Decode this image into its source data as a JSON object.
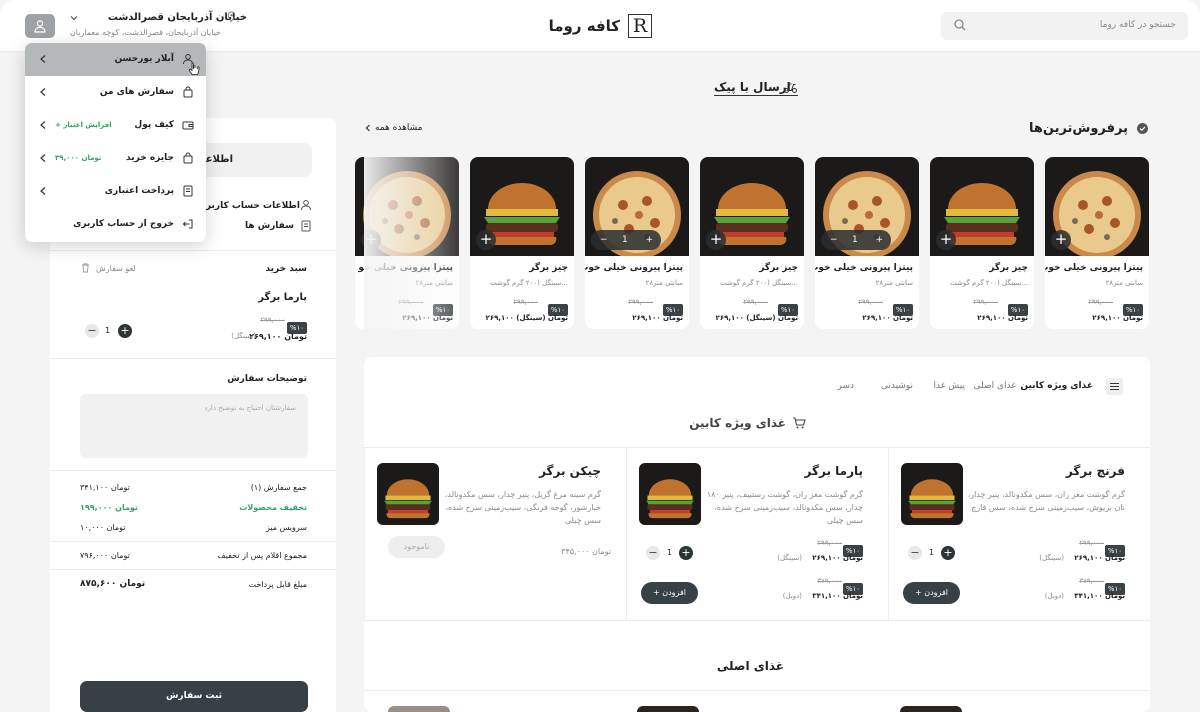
{
  "header": {
    "brand_name": "کافه روما",
    "brand_mark": "R",
    "search_placeholder": "جستجو در کافه روما",
    "address_title": "خیابان آذربایجان قصرالدشت",
    "address_sub": "خیابان آذربایجان، قصرالدشت، کوچه معماریان"
  },
  "user_menu": {
    "items": [
      {
        "label": "آبلار یورحسن",
        "extra": ""
      },
      {
        "label": "سفارش های من",
        "extra": ""
      },
      {
        "label": "کیف پول",
        "extra": "+ افزایش اعتبار"
      },
      {
        "label": "جایزه خرید",
        "extra": "۳۹,۰۰۰ تومان"
      },
      {
        "label": "پرداخت اعتباری",
        "extra": ""
      },
      {
        "label": "خروج از حساب کاربری",
        "extra": ""
      }
    ]
  },
  "side": {
    "account_tab": "اطلاعا",
    "links": [
      "اطلاعات حساب کاربری",
      "سفارش ها"
    ],
    "cart_title": "سبد خرید",
    "cancel_order": "لغو سفارش",
    "item_name": "پارما برگر",
    "item_discount": "%۱۰",
    "item_old_price": "۲۹۹,۰۰۰",
    "item_price": "۲۶۹,۱۰۰ تومان",
    "item_variant": "(سینگل)",
    "item_qty": "1",
    "notes_title": "توضیحات سفارش",
    "notes_placeholder": "سفارشتان احتیاج به توضیح دارد",
    "summary": [
      {
        "label": "جمع سفارش (۱)",
        "value": "۳۴۱,۱۰۰ تومان"
      },
      {
        "label": "تخفیف محصولات",
        "value": "۱۹۹,۰۰۰ تومان"
      },
      {
        "label": "سرویس میز",
        "value": "۱۰,۰۰۰ تومان"
      },
      {
        "label": "مجموع اقلام پس از تخفیف",
        "value": "۷۹۶,۰۰۰ تومان"
      },
      {
        "label": "مبلغ قابل پرداخت",
        "value": "۸۷۵,۶۰۰ تومان"
      }
    ],
    "submit_label": "ثبت سفارش"
  },
  "main": {
    "delivery_label": "ارسال با پیک",
    "bestsellers_title": "پرفروش‌ترین‌ها",
    "see_all": "مشاهده همه",
    "cards": [
      {
        "name": "پیتزا پیرونی خیلی خوب",
        "sub": "۲۸سانتی متر",
        "discount": "%۱۰",
        "old": "۲۹۹,۰۰۰",
        "price": "۲۶۹,۱۰۰ تومان",
        "kind": "pizza",
        "qty": ""
      },
      {
        "name": "چیز برگر",
        "sub": "سینگل (۲۰۰ گرم گوشت...",
        "discount": "%۱۰",
        "old": "۲۹۹,۰۰۰",
        "price": "۲۶۹,۱۰۰ تومان",
        "kind": "burger",
        "qty": ""
      },
      {
        "name": "پیتزا پیرونی خیلی خوب",
        "sub": "۲۸سانتی متر",
        "discount": "%۱۰",
        "old": "۲۹۹,۰۰۰",
        "price": "۲۶۹,۱۰۰ تومان",
        "kind": "pizza",
        "qty": "1"
      },
      {
        "name": "چیز برگر",
        "sub": "سینگل (۲۰۰ گرم گوشت...",
        "discount": "%۱۰",
        "old": "۲۹۹,۰۰۰",
        "price": "۲۶۹,۱۰۰ تومان (سینگل)",
        "kind": "burger",
        "qty": ""
      },
      {
        "name": "پیتزا پیرونی خیلی خوب",
        "sub": "۲۸سانتی متر",
        "discount": "%۱۰",
        "old": "۲۹۹,۰۰۰",
        "price": "۲۶۹,۱۰۰ تومان",
        "kind": "pizza",
        "qty": "1"
      },
      {
        "name": "چیز برگر",
        "sub": "سینگل (۲۰۰ گرم گوشت...",
        "discount": "%۱۰",
        "old": "۲۹۹,۰۰۰",
        "price": "۲۶۹,۱۰۰ تومان (سینگل)",
        "kind": "burger",
        "qty": ""
      },
      {
        "name": "پیتزا پیرونی خیلی خو",
        "sub": "۲۸سانتی متر",
        "discount": "%۱۰",
        "old": "۲۹۹,۰۰۰",
        "price": "۲۶۹,۱۰۰ تومان",
        "kind": "pizza",
        "qty": ""
      }
    ],
    "tabs": [
      "غذای ویژه کابین",
      "غذای اصلی",
      "پیش غذا",
      "نوشیدنی",
      "دسر"
    ],
    "special_title": "غذای ویژه کابین",
    "main_title": "غذای اصلی",
    "foods": [
      {
        "name": "فرنچ برگر",
        "desc": "گرم گوشت مغز ران، سس مکدونالد، پنیر چدار، نان بریوش، سیب‌زمینی سرخ شده، سس قارچ",
        "price1_old": "۲۹۹,۰۰۰",
        "price1": "۲۶۹,۱۰۰ تومان",
        "price1_var": "(سینگل)",
        "price2_old": "۳۷۹,۰۰۰",
        "price2": "۳۴۱,۱۰۰ تومان",
        "price2_var": "(دوبل)",
        "qty": "1",
        "button": "افزودن"
      },
      {
        "name": "پارما برگر",
        "desc": "۱۸۰ گرم گوشت مغز ران، گوشت رستبیف، پنیر چدار، سس مکدونالد، سیب‌زمینی سرخ شده، سس چیلی",
        "price1_old": "۲۹۹,۰۰۰",
        "price1": "۲۶۹,۱۰۰ تومان",
        "price1_var": "(سینگل)",
        "price2_old": "۳۷۹,۰۰۰",
        "price2": "۳۴۱,۱۰۰ تومان",
        "price2_var": "(دوبل)",
        "qty": "1",
        "button": "افزودن"
      },
      {
        "name": "چیکن برگر",
        "desc": "گرم سینه مرغ گریل، پنیر چدار، سس مکدونالد، خیارشور، گوجه فرنگی، سیب‌زمینی سرخ شده، سس چیلی",
        "price1_old": "",
        "price1": "۳۴۵,۰۰۰ تومان",
        "price1_var": "",
        "price2_old": "",
        "price2": "",
        "price2_var": "",
        "qty": "",
        "button": "ناموجود"
      }
    ]
  },
  "colors": {
    "dark": "#374044",
    "green": "#2fa36b",
    "bg": "#f4f4f4"
  }
}
